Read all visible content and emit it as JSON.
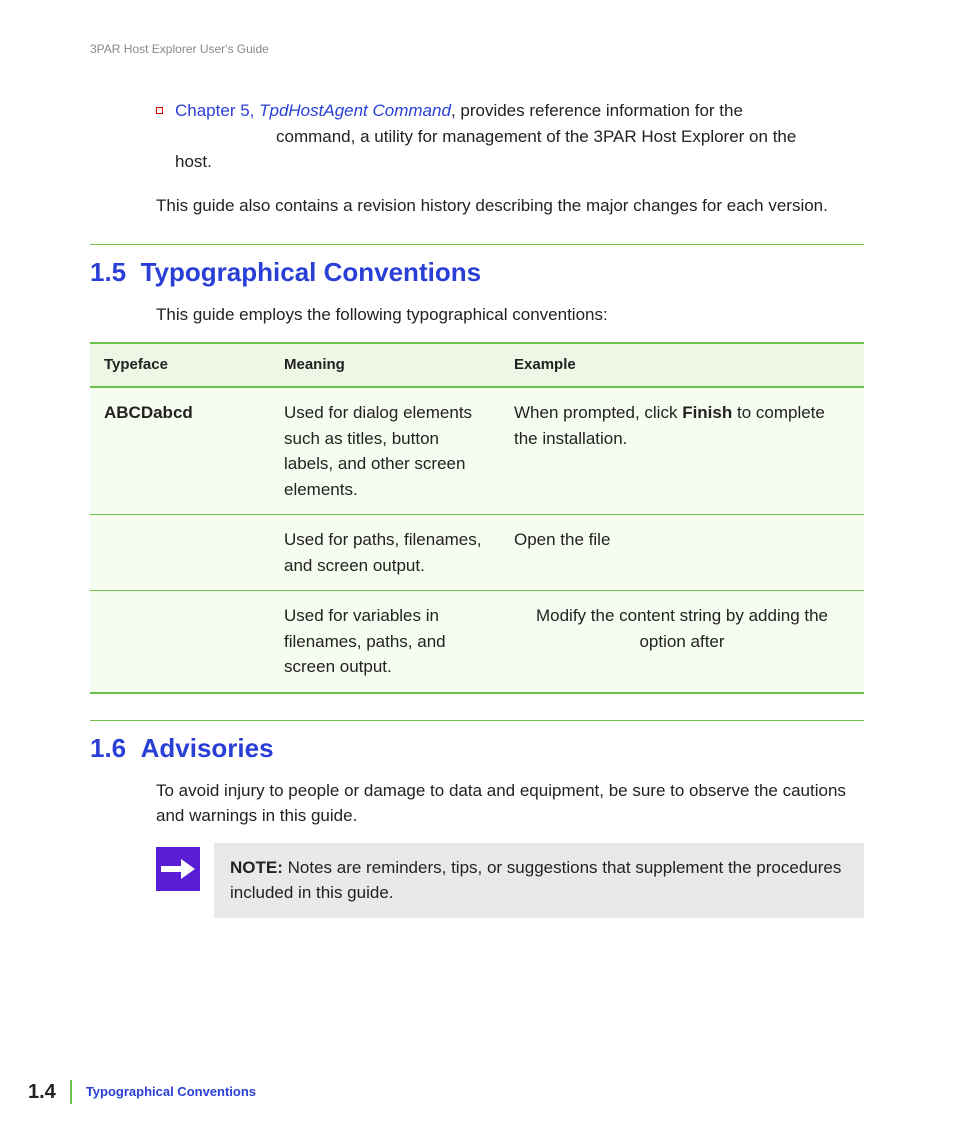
{
  "header": {
    "running_title": "3PAR Host Explorer User's Guide"
  },
  "bullet": {
    "chapter_ref": "Chapter 5, ",
    "chapter_title": "TpdHostAgent Command",
    "after_ref": ", provides reference information for the",
    "cont1": "command, a utility for management of the 3PAR Host Explorer on the",
    "cont2": "host."
  },
  "intro_para": "This guide also contains a revision history describing the major changes for each version.",
  "section_15": {
    "number": "1.5",
    "title": "Typographical Conventions",
    "lead": "This guide employs the following typographical conventions:",
    "columns": {
      "c1": "Typeface",
      "c2": "Meaning",
      "c3": "Example"
    },
    "rows": [
      {
        "typeface": "ABCDabcd",
        "meaning": "Used for dialog elements such as titles, button labels, and other screen elements.",
        "example_pre": "When prompted, click ",
        "example_bold": "Finish",
        "example_post": " to complete the installation."
      },
      {
        "typeface": "",
        "meaning": "Used for paths, filenames, and screen output.",
        "example_pre": "Open the file",
        "example_bold": "",
        "example_post": ""
      },
      {
        "typeface": "",
        "meaning": "Used for variables in filenames, paths, and screen output.",
        "example_pre": "Modify the content string by adding the",
        "example_bold": "",
        "example_post": " option after"
      }
    ]
  },
  "section_16": {
    "number": "1.6",
    "title": "Advisories",
    "lead": "To avoid injury to people or damage to data and equipment, be sure to observe the cautions and warnings in this guide.",
    "note_label": "NOTE:",
    "note_body": " Notes are reminders, tips, or suggestions that supplement the procedures included in this guide."
  },
  "footer": {
    "page": "1.4",
    "title": "Typographical Conventions"
  }
}
